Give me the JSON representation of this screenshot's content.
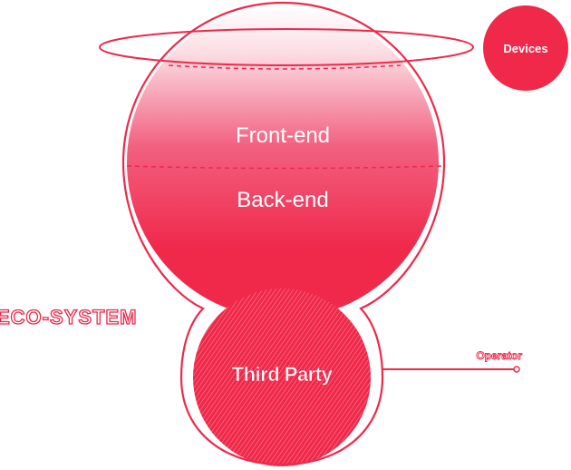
{
  "diagram": {
    "labels": {
      "frontend": "Front-end",
      "backend": "Back-end",
      "devices": "Devices",
      "ecosystem": "ECO-SYSTEM",
      "third_party": "Third Party",
      "operator": "Operator"
    },
    "colors": {
      "accent": "#f0284a",
      "accent_light": "#fde3e8",
      "label_white": "#ffffff",
      "background": "#ffffff"
    }
  }
}
